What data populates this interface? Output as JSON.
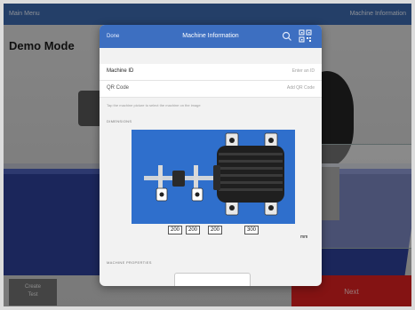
{
  "topbar": {
    "left": "Main Menu",
    "right": "Machine Information"
  },
  "background": {
    "demo_label": "Demo Mode",
    "left_button": "Create\nTest",
    "right_button": "Next"
  },
  "modal": {
    "header": {
      "done": "Done",
      "title": "Machine Information"
    },
    "machine_id": {
      "label": "Machine ID",
      "placeholder": "Enter an ID"
    },
    "qr_code": {
      "label": "QR Code",
      "action": "Add QR Code"
    },
    "hint": "Tap the machine picture to select the machine on the image",
    "dimensions_header": "DIMENSIONS",
    "dimensions": [
      "200",
      "200",
      "200",
      "300"
    ],
    "unit": "mm",
    "machine_properties_header": "MACHINE PROPERTIES"
  },
  "colors": {
    "accent": "#3d6fc1",
    "base": "#2d3e94",
    "danger": "#d51f1f"
  }
}
